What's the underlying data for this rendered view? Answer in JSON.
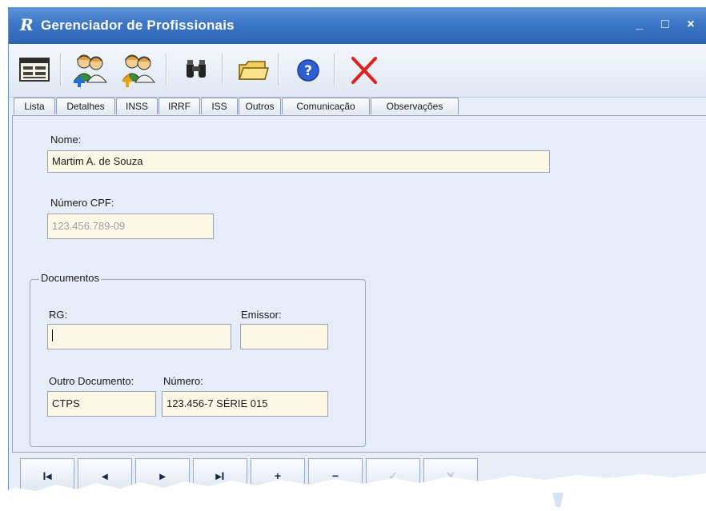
{
  "window": {
    "title": "Gerenciador de Profissionais",
    "app_icon": "R",
    "controls": {
      "minimize": "_",
      "maximize": "□",
      "close": "×"
    }
  },
  "toolbar": {
    "buttons": [
      {
        "name": "list-view-button",
        "icon": "list-form-icon"
      },
      {
        "name": "add-professional-button",
        "icon": "add-user-icon"
      },
      {
        "name": "edit-professional-button",
        "icon": "edit-user-icon"
      },
      {
        "name": "search-button",
        "icon": "binoculars-icon"
      },
      {
        "name": "open-folder-button",
        "icon": "folder-icon"
      },
      {
        "name": "help-button",
        "icon": "help-icon"
      },
      {
        "name": "close-button",
        "icon": "red-x-icon"
      }
    ]
  },
  "tabs": [
    "Lista",
    "Detalhes",
    "INSS",
    "IRRF",
    "ISS",
    "Outros",
    "Comunicação",
    "Observações"
  ],
  "form": {
    "nome_label": "Nome:",
    "nome_value": "Martim A. de Souza",
    "cpf_label": "Número CPF:",
    "cpf_value": "123.456.789-09",
    "documentos_title": "Documentos",
    "rg_label": "RG:",
    "rg_value": "",
    "emissor_label": "Emissor:",
    "emissor_value": "",
    "outro_doc_label": "Outro Documento:",
    "outro_doc_value": "CTPS",
    "numero_label": "Número:",
    "numero_value": "123.456-7 SÉRIE 015"
  },
  "navigator": {
    "buttons": [
      {
        "name": "first-record-button",
        "glyph": "I◂"
      },
      {
        "name": "prior-record-button",
        "glyph": "◂"
      },
      {
        "name": "next-record-button",
        "glyph": "▸"
      },
      {
        "name": "last-record-button",
        "glyph": "▸I"
      },
      {
        "name": "insert-record-button",
        "glyph": "+"
      },
      {
        "name": "delete-record-button",
        "glyph": "−"
      },
      {
        "name": "post-record-button",
        "glyph": "✓"
      },
      {
        "name": "cancel-record-button",
        "glyph": "✕"
      }
    ]
  },
  "colors": {
    "titlebar": "#3d76c6",
    "field_bg": "#fdf8e6",
    "panel_bg": "#e6edf8",
    "close_x": "#e0201a"
  }
}
